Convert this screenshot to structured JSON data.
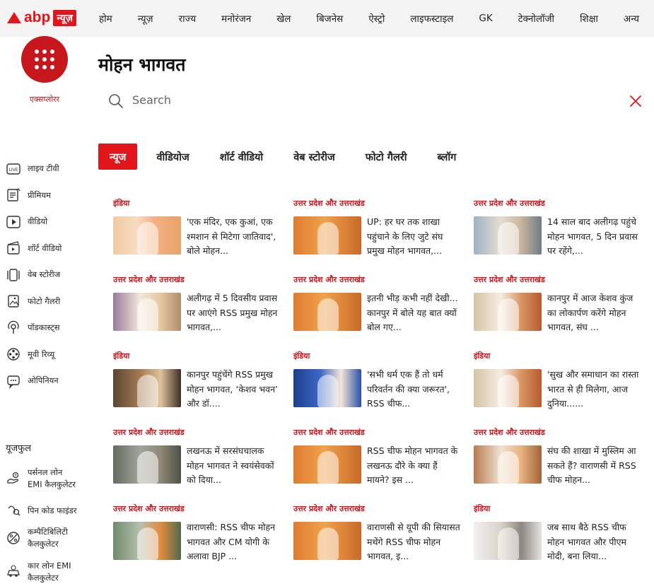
{
  "header": {
    "logo_text": "abp",
    "logo_badge": "न्यूज़",
    "nav": [
      "होम",
      "न्यूज़",
      "राज्य",
      "मनोरंजन",
      "खेल",
      "बिजनेस",
      "ऐस्ट्रो",
      "लाइफस्टाइल",
      "GK",
      "टेक्नोलॉजी",
      "शिक्षा",
      "अन्य"
    ]
  },
  "explore_label": "एक्सप्लोरर",
  "page_title": "मोहन भागवत",
  "search": {
    "placeholder": "Search",
    "value": ""
  },
  "sidebar": {
    "items": [
      {
        "label": "लाइव टीवी",
        "icon": "live-tv-icon"
      },
      {
        "label": "प्रीमियम",
        "icon": "premium-icon"
      },
      {
        "label": "वीडियो",
        "icon": "video-play-icon"
      },
      {
        "label": "शॉर्ट वीडियो",
        "icon": "short-video-icon"
      },
      {
        "label": "वेब स्टोरीज",
        "icon": "web-stories-icon"
      },
      {
        "label": "फोटो गैलरी",
        "icon": "photo-gallery-icon"
      },
      {
        "label": "पॉडकास्ट्स",
        "icon": "podcast-icon"
      },
      {
        "label": "मूवी रिव्यू",
        "icon": "movie-reel-icon"
      },
      {
        "label": "ओपिनियन",
        "icon": "opinion-chat-icon"
      }
    ],
    "utilities_heading": "यूजफुल",
    "utilities": [
      {
        "line1": "पर्सनल लोन",
        "line2": "EMI कैलकुलेटर",
        "icon": "personal-loan-icon"
      },
      {
        "line1": "पिन कोड फाइंडर",
        "line2": "",
        "icon": "pin-code-icon"
      },
      {
        "line1": "कम्पैटिबिलिटी",
        "line2": "कैलकुलेटर",
        "icon": "compatibility-icon"
      },
      {
        "line1": "कार लोन EMI",
        "line2": "कैलकुलेटर",
        "icon": "car-loan-icon"
      }
    ]
  },
  "tabs": [
    "न्यूज",
    "वीडियोज",
    "शॉर्ट वीडियो",
    "वेब स्टोरीज",
    "फोटो गैलरी",
    "ब्लॉग"
  ],
  "articles": [
    {
      "category": "इंडिया",
      "headline": "'एक मंदिर, एक कुआं, एक श्मशान से मिटेगा जातिवाद', बोले मोहन..."
    },
    {
      "category": "उत्तर प्रदेश और उत्तराखंड",
      "headline": "UP: हर घर तक शाखा पहुंचाने के लिए जुटे संघ प्रमुख मोहन भागवत,..."
    },
    {
      "category": "उत्तर प्रदेश और उत्तराखंड",
      "headline": "14 साल बाद अलीगढ़ पहुंचे मोहन भागवत, 5 दिन प्रवास पर रहेंगे,..."
    },
    {
      "category": "उत्तर प्रदेश और उत्तराखंड",
      "headline": "अलीगढ़ में 5 दिवसीय प्रवास पर आएंगे RSS प्रमुख मोहन भागवत,..."
    },
    {
      "category": "उत्तर प्रदेश और उत्तराखंड",
      "headline": "इतनी भीड़ कभी नहीं देखी... कानपुर में बोले यह बात क्यों बोल गए..."
    },
    {
      "category": "उत्तर प्रदेश और उत्तराखंड",
      "headline": "कानपुर में आज केशव कुंज का लोकार्पण करेंगे मोहन भागवत, संघ ..."
    },
    {
      "category": "इंडिया",
      "headline": "कानपुर पहुंचेंगे RSS प्रमुख मोहन भागवत, ‘केशव भवन’ और डॉ...."
    },
    {
      "category": "इंडिया",
      "headline": "'सभी धर्म एक हैं तो धर्म परिवर्तन की क्या जरूरत', RSS चीफ..."
    },
    {
      "category": "इंडिया",
      "headline": "'सुख और समाधान का रास्ता भारत से ही मिलेगा, आज दुनिया......"
    },
    {
      "category": "उत्तर प्रदेश और उत्तराखंड",
      "headline": "लखनऊ में सरसंघचालक मोहन भागवत ने स्वयंसेवकों को दिया..."
    },
    {
      "category": "उत्तर प्रदेश और उत्तराखंड",
      "headline": "RSS चीफ मोहन भागवत के लखनऊ दौरे के क्या हैं मायने? इस ..."
    },
    {
      "category": "उत्तर प्रदेश और उत्तराखंड",
      "headline": "संघ की शाखा में मुस्लिम आ सकते हैं? वाराणसी में RSS चीफ मोहन..."
    },
    {
      "category": "उत्तर प्रदेश और उत्तराखंड",
      "headline": "वाराणसी: RSS चीफ मोहन भागवत और CM योगी के अलावा BJP ..."
    },
    {
      "category": "उत्तर प्रदेश और उत्तराखंड",
      "headline": "वाराणसी से यूपी की सियासत मथेंगे RSS चीफ मोहन भागवत, इ..."
    },
    {
      "category": "इंडिया",
      "headline": "जब साथ बैठे RSS चीफ मोहन भागवत और पीएम मोदी, बना लिया..."
    }
  ],
  "colors": {
    "accent": "#e2151b",
    "category_red": "#c8161d",
    "header_bg": "#f3f3f3"
  }
}
